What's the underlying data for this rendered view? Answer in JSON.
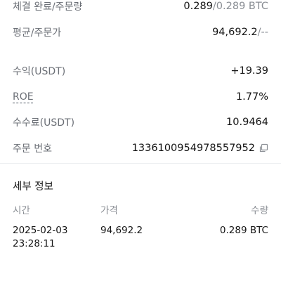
{
  "summary": {
    "filled": {
      "label": "체결 완료/주문량",
      "value_main": "0.289",
      "value_rest": "/0.289 BTC"
    },
    "avg_price": {
      "label": "평균/주문가",
      "value_main": "94,692.2",
      "value_rest": "/--"
    },
    "pnl": {
      "label": "수익(USDT)",
      "value": "+19.39"
    },
    "roe": {
      "label": "ROE",
      "value": "1.77%"
    },
    "fee": {
      "label": "수수료(USDT)",
      "value": "10.9464"
    },
    "order_id": {
      "label": "주문 번호",
      "value": "1336100954978557952",
      "icon": "copy-icon"
    }
  },
  "details": {
    "title": "세부 정보",
    "columns": {
      "time": "시간",
      "price": "가격",
      "amount": "수량"
    },
    "rows": [
      {
        "date": "2025-02-03",
        "time": "23:28:11",
        "price": "94,692.2",
        "amount": "0.289 BTC"
      }
    ]
  }
}
